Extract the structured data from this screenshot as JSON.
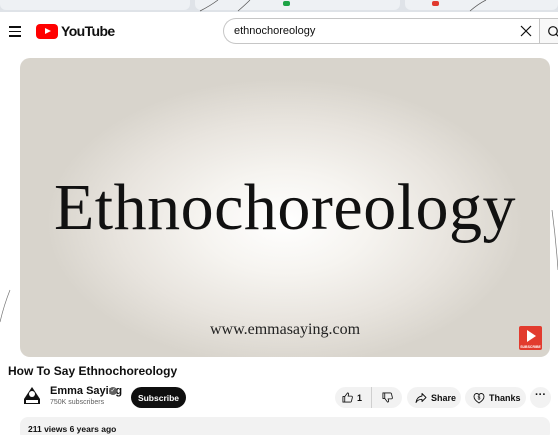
{
  "header": {
    "logo_text": "YouTube",
    "search_value": "ethnochoreology"
  },
  "video": {
    "overlay_word": "Ethnochoreology",
    "overlay_url": "www.emmasaying.com",
    "badge_text": "SUBSCRIBE"
  },
  "title": "How To Say Ethnochoreology",
  "channel": {
    "name": "Emma Saying",
    "subscribers": "750K subscribers",
    "subscribe_label": "Subscribe"
  },
  "actions": {
    "like_count": "1",
    "share_label": "Share",
    "thanks_label": "Thanks"
  },
  "description": {
    "meta": "211 views  6 years ago"
  },
  "colors": {
    "brand_red": "#ff0000",
    "pill_bg": "#f2f2f2",
    "subscribe_bg": "#0f0f0f"
  },
  "icons": [
    "menu-icon",
    "youtube-logo-icon",
    "clear-icon",
    "search-icon",
    "verified-icon",
    "like-icon",
    "dislike-icon",
    "share-icon",
    "thanks-icon",
    "more-icon",
    "subscribe-badge-icon"
  ]
}
